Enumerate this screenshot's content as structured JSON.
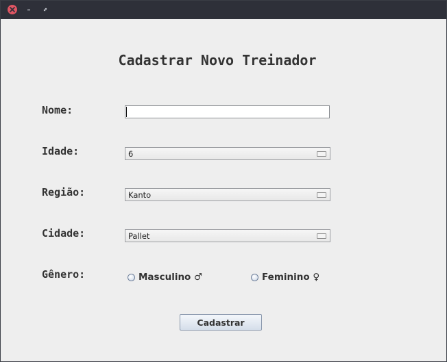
{
  "form": {
    "title": "Cadastrar Novo Treinador",
    "nome": {
      "label": "Nome:",
      "value": ""
    },
    "idade": {
      "label": "Idade:",
      "selected": "6"
    },
    "regiao": {
      "label": "Região:",
      "selected": "Kanto"
    },
    "cidade": {
      "label": "Cidade:",
      "selected": "Pallet"
    },
    "genero": {
      "label": "Gênero:",
      "options": [
        {
          "label": "Masculino ♂",
          "checked": false
        },
        {
          "label": "Feminino ♀",
          "checked": false
        }
      ]
    },
    "submit_label": "Cadastrar"
  },
  "colors": {
    "close_button": "#e05563",
    "titlebar": "#2e3039",
    "background": "#eeeeee"
  }
}
